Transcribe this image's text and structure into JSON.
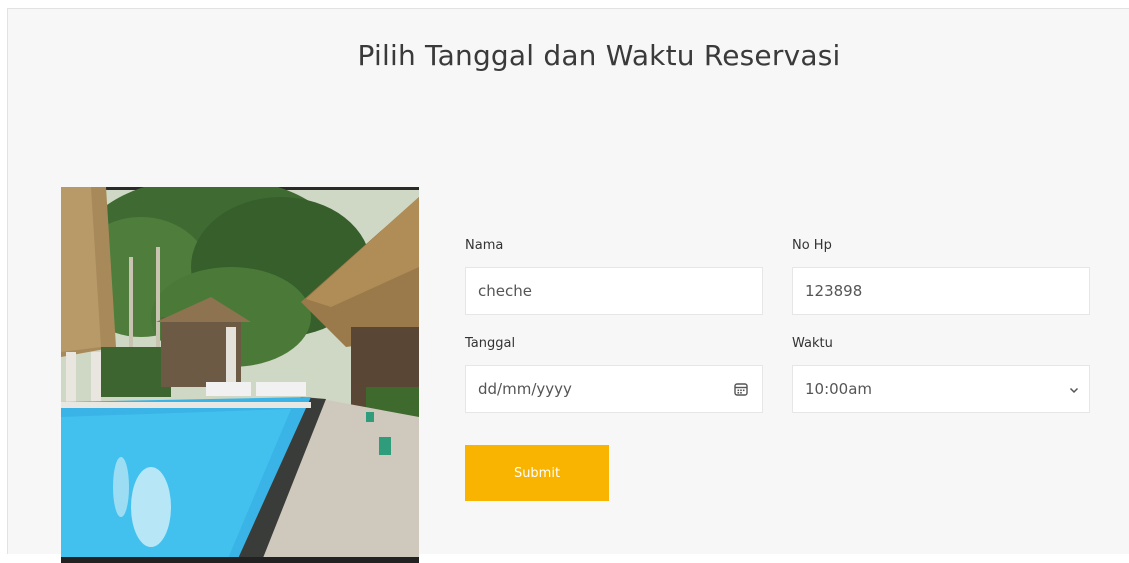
{
  "page": {
    "title": "Pilih Tanggal dan Waktu Reservasi"
  },
  "image": {
    "icon": "pool-photo"
  },
  "form": {
    "nama": {
      "label": "Nama",
      "value": "cheche"
    },
    "nohp": {
      "label": "No Hp",
      "value": "123898"
    },
    "tanggal": {
      "label": "Tanggal",
      "placeholder": "dd/mm/yyyy",
      "icon": "calendar-icon"
    },
    "waktu": {
      "label": "Waktu",
      "value": "10:00am",
      "icon": "chevron-down-icon"
    },
    "submit_label": "Submit"
  },
  "colors": {
    "accent": "#f8b400",
    "background": "#f7f7f7",
    "text": "#3a3a3a"
  }
}
